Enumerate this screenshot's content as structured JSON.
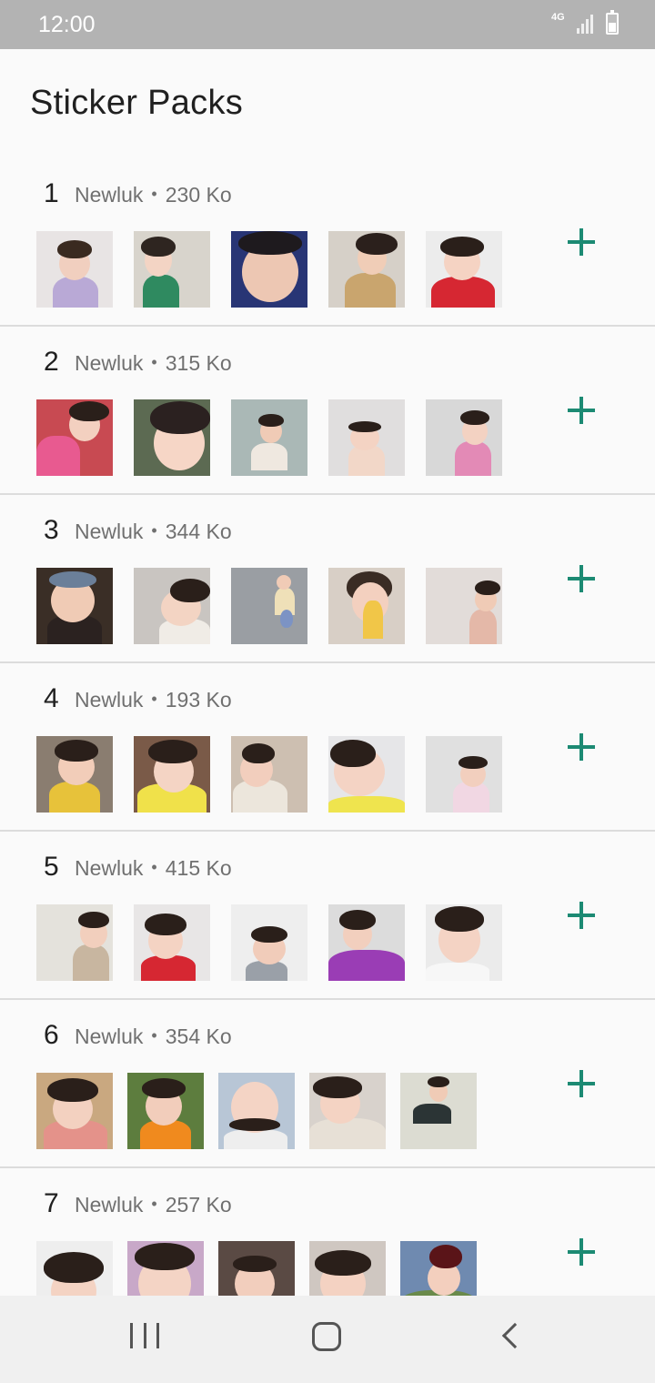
{
  "status_bar": {
    "time": "12:00",
    "network": "4G",
    "icons": [
      "4g-icon",
      "signal-icon",
      "battery-icon"
    ]
  },
  "header": {
    "title": "Sticker Packs"
  },
  "colors": {
    "accent": "#1c8a73",
    "background": "#fafafa",
    "status_bar": "#b3b3b3"
  },
  "packs": [
    {
      "number": "1",
      "name": "Newluk",
      "separator": "•",
      "size": "230 Ko",
      "sticker_count_shown": 5
    },
    {
      "number": "2",
      "name": "Newluk",
      "separator": "•",
      "size": "315 Ko",
      "sticker_count_shown": 5
    },
    {
      "number": "3",
      "name": "Newluk",
      "separator": "•",
      "size": "344 Ko",
      "sticker_count_shown": 5
    },
    {
      "number": "4",
      "name": "Newluk",
      "separator": "•",
      "size": "193 Ko",
      "sticker_count_shown": 5
    },
    {
      "number": "5",
      "name": "Newluk",
      "separator": "•",
      "size": "415 Ko",
      "sticker_count_shown": 5
    },
    {
      "number": "6",
      "name": "Newluk",
      "separator": "•",
      "size": "354 Ko",
      "sticker_count_shown": 5
    },
    {
      "number": "7",
      "name": "Newluk",
      "separator": "•",
      "size": "257 Ko",
      "sticker_count_shown": 5
    }
  ],
  "nav_bar": {
    "icons": [
      "recent-apps-icon",
      "home-icon",
      "back-icon"
    ]
  }
}
